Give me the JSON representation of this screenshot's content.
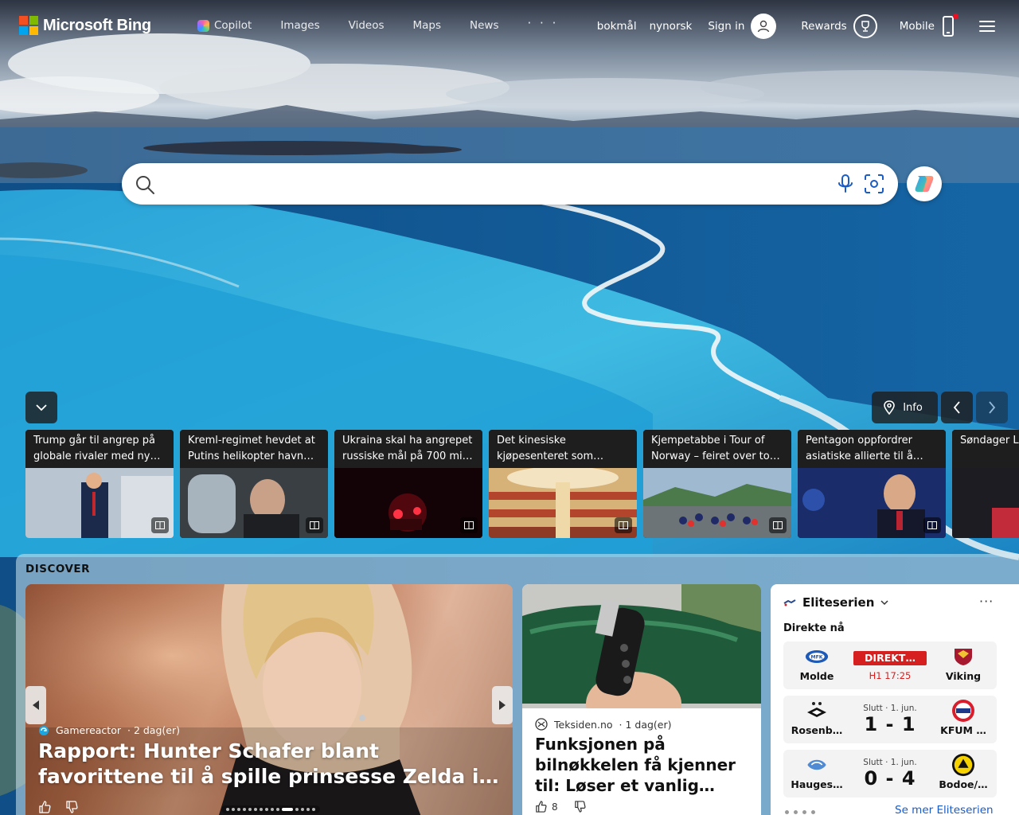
{
  "header": {
    "logo_text": "Microsoft Bing",
    "nav": [
      {
        "label": "Copilot"
      },
      {
        "label": "Images"
      },
      {
        "label": "Videos"
      },
      {
        "label": "Maps"
      },
      {
        "label": "News"
      },
      {
        "label": "· · ·"
      }
    ],
    "lang_1": "bokmål",
    "lang_2": "nynorsk",
    "sign_in": "Sign in",
    "rewards": "Rewards",
    "mobile": "Mobile"
  },
  "search": {
    "value": "",
    "placeholder": ""
  },
  "carousel": {
    "info_label": "Info"
  },
  "news": [
    {
      "title": "Trump går til angrep på globale rivaler med ny…"
    },
    {
      "title": "Kreml-regimet hevdet at Putins helikopter havn…"
    },
    {
      "title": "Ukraina skal ha angrepet russiske mål på 700 mi…"
    },
    {
      "title": "Det kinesiske kjøpesenteret som…"
    },
    {
      "title": "Kjempetabbe i Tour of Norway – feiret over to…"
    },
    {
      "title": "Pentagon oppfordrer asiatiske allierte til å…"
    },
    {
      "title": "Søndager League-ry…"
    }
  ],
  "discover": {
    "label": "DISCOVER",
    "hero": {
      "source": "Gamereactor",
      "age": "· 2 dag(er)",
      "title": "Rapport: Hunter Schafer blant favorittene til å spille prinsesse Zelda i live-action…"
    },
    "card2": {
      "source": "Teksiden.no",
      "age": "· 1 dag(er)",
      "title": "Funksjonen på bilnøkkelen få kjenner til: Løser et vanlig…",
      "likes": "8"
    },
    "sports": {
      "league": "Eliteserien",
      "more": "···",
      "live_label": "Direkte nå",
      "matches": [
        {
          "home": "Molde",
          "away": "Viking",
          "status": "DIREKT…",
          "time": "H1 17:25"
        },
        {
          "home": "Rosenb…",
          "away": "KFUM …",
          "status": "Slutt · 1. jun.",
          "score": "1 - 1"
        },
        {
          "home": "Hauges…",
          "away": "Bodoe/…",
          "status": "Slutt · 1. jun.",
          "score": "0 - 4"
        }
      ],
      "link": "Se mer Eliteserien"
    }
  },
  "colors": {
    "accent": "#1a5bc4",
    "live": "#d62020"
  }
}
